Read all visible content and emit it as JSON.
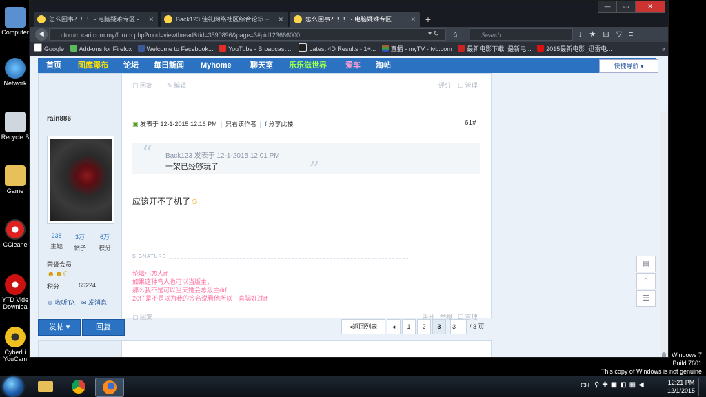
{
  "desktop": {
    "icons": [
      "Computer",
      "Network",
      "Recycle B",
      "Game",
      "CCleane",
      "YTD Vide Downloa",
      "CyberLi YouCam"
    ],
    "watermark": [
      "Windows 7",
      "Build 7601",
      "This copy of Windows is not genuine"
    ]
  },
  "taskbar": {
    "lang": "CH",
    "time": "12:21 PM",
    "date": "12/1/2015"
  },
  "browser": {
    "tabs": [
      {
        "title": "怎么回事？！！ - 电脑疑难专区 - ..."
      },
      {
        "title": "Back123 佳礼网络社区综合论坛 ~ ..."
      },
      {
        "title": "怎么回事？！！ - 电脑疑难专区 ..."
      }
    ],
    "new_tab": "+",
    "url": "cforum.cari.com.my/forum.php?mod=viewthread&tid=3590896&page=3#pid123666000",
    "search_placeholder": "Search",
    "bookmarks": [
      "Google",
      "Add-ons for Firefox",
      "Welcome to Facebook...",
      "YouTube - Broadcast ...",
      "Latest 4D Results - 1+...",
      "直播 - myTV - tvb.com",
      "最新电影下载, 最新电...",
      "2015最新电影_迅雷电..."
    ],
    "bookmark_more": "»"
  },
  "site_nav": {
    "items": [
      "首页",
      "图库瀑布",
      "论坛",
      "每日新闻",
      "Myhome",
      "聊天室",
      "乐乐滋世界",
      "爱车",
      "淘帖"
    ],
    "quick_nav": "快捷导航"
  },
  "post": {
    "prev_actions": {
      "reply": "回复",
      "edit": "编辑",
      "rate": "评分",
      "manage": "管理"
    },
    "username": "rain886",
    "stats": [
      {
        "value": "238",
        "label": "主题"
      },
      {
        "value": "3万",
        "label": "帖子"
      },
      {
        "value": "6万",
        "label": "积分"
      }
    ],
    "rank": "荣誉会员",
    "points_label": "积分",
    "points_value": "65224",
    "follow": "收听TA",
    "send_msg": "发消息",
    "posted_at": "发表于 12-1-2015 12:16 PM",
    "only_author": "只看该作者",
    "share": "分享此楼",
    "floor": "61#",
    "quote_author": "Back123 发表于 12-1-2015 12:01 PM",
    "quote_text": "一架已经够玩了",
    "message": "应该开不了机了",
    "signature_label": "SIGNATURE",
    "signature": [
      "论坛小恋人rf",
      "如果这种鸟人也可以当版主，",
      "那么我不是可以当天她会总版主rfrf",
      "26仔是不是以为我的签名说看他所以一直骗好过rf"
    ],
    "bottom_actions": {
      "reply": "回复",
      "rate": "评分",
      "report": "举报",
      "manage": "管理"
    }
  },
  "pagination": {
    "post_button": "发帖",
    "reply_button": "回复",
    "back_to_list": "返回列表",
    "pages": [
      "1",
      "2",
      "3"
    ],
    "current_page_value": "3",
    "total": "/ 3 页"
  }
}
